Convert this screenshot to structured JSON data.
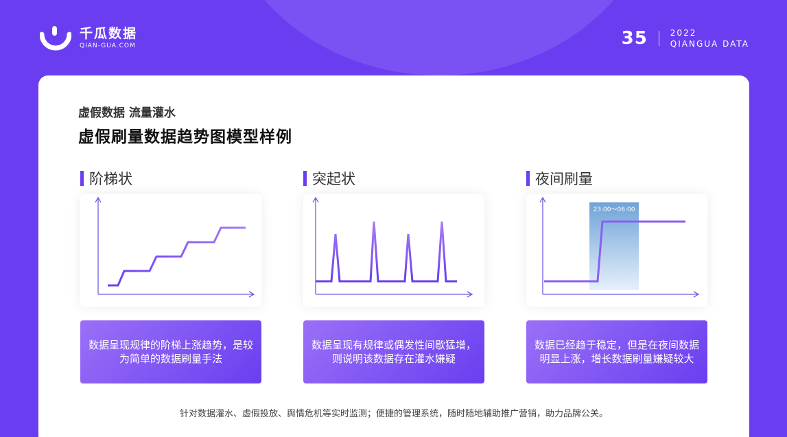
{
  "brand": {
    "name_cn": "千瓜数据",
    "name_en": "QIAN-GUA.COM"
  },
  "page": {
    "number": "35",
    "year": "2022",
    "subtitle_en": "QIANGUA DATA"
  },
  "header": {
    "subtitle": "虚假数据 流量灌水",
    "title": "虚假刷量数据趋势图模型样例"
  },
  "columns": [
    {
      "label": "阶梯状",
      "desc": "数据呈现规律的阶梯上涨趋势，是较为简单的数据刷量手法"
    },
    {
      "label": "突起状",
      "desc": "数据呈现有规律或偶发性间歇猛增，则说明该数据存在灌水嫌疑"
    },
    {
      "label": "夜间刷量",
      "desc": "数据已经趋于稳定，但是在夜间数据明显上涨，增长数据刷量嫌疑较大",
      "time_range": "23:00～06:00"
    }
  ],
  "footer": "针对数据灌水、虚假投放、舆情危机等实时监测；便捷的管理系统，随时随地辅助推广营销，助力品牌公关。",
  "colors": {
    "accent": "#6a3ef0",
    "line": "#8a5ff2",
    "highlight": "#7fb0de"
  }
}
